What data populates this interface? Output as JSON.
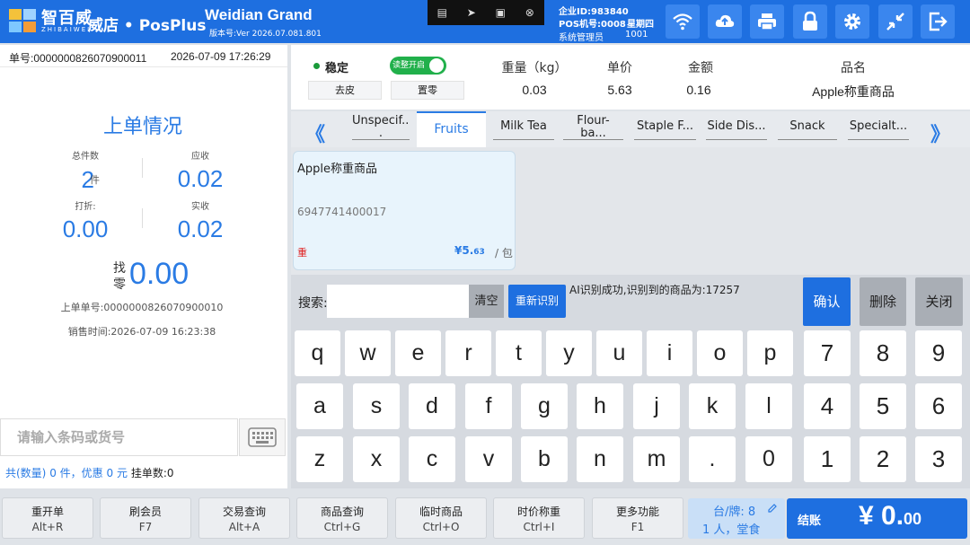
{
  "header": {
    "brand_cn": "智百威",
    "brand_en": "ZHIBAIWEI",
    "app_name": "威店 • PosPlus",
    "store_name": "Weidian Grand",
    "version": "版本号:Ver 2026.07.081.801",
    "company_id": "企业ID:983840",
    "pos_id": "POS机号:0008",
    "weekday": "星期四",
    "role": "系统管理员",
    "user_id": "1001",
    "toolbar_icons": [
      "wifi-icon",
      "cloud-upload-icon",
      "printer-icon",
      "lock-icon",
      "gear-icon",
      "minimize-icon",
      "exit-icon"
    ]
  },
  "order": {
    "number": "单号:0000000826070900011",
    "datetime": "2026-07-09 17:26:29",
    "title": "上单情况",
    "total_count_label": "总件数",
    "total_count": "2",
    "count_unit": "件",
    "receivable_label": "应收",
    "receivable": "0.02",
    "discount_label": "打折:",
    "discount": "0.00",
    "paid_label": "实收",
    "paid": "0.02",
    "change_label": "找零",
    "change": "0.00",
    "last_order": "上单单号:0000000826070900010",
    "sale_time": "销售时间:2026-07-09 16:23:38",
    "barcode_placeholder": "请输入条码或货号",
    "summary_prefix": "共(数量)",
    "summary_qty": "0",
    "summary_mid": "件，优惠",
    "summary_discount": "0",
    "summary_unit": "元",
    "pending_label": "挂单数:0"
  },
  "scale": {
    "stable_label": "稳定",
    "toggle_label": "读整开启",
    "tare_label": "去皮",
    "zero_label": "置零",
    "weight_label": "重量（kg）",
    "weight": "0.03",
    "unit_price_label": "单价",
    "unit_price": "5.63",
    "amount_label": "金额",
    "amount": "0.16",
    "product_label": "品名",
    "product_name": "Apple称重商品"
  },
  "tabs": [
    "Unspecif...",
    "Fruits",
    "Milk Tea",
    "Flour-ba...",
    "Staple F...",
    "Side Dis...",
    "Snack",
    "Specialt..."
  ],
  "tab_unspecified_line1": "Unspecif...",
  "tab_unspecified_line2": ".",
  "tab_flour_line1": "Flour-",
  "tab_flour_line2": "ba...",
  "arrow_left": "《",
  "arrow_right": "》",
  "product_card": {
    "name": "Apple称重商品",
    "code": "6947741400017",
    "weigh_tag": "重",
    "price_main": "¥5.",
    "price_cents": "63",
    "unit": "/ 包"
  },
  "search": {
    "label": "搜索:",
    "value": "",
    "clear_label": "清空",
    "recognize_label": "重新识别",
    "ai_message": "AI识别成功,识别到的商品为:17257"
  },
  "actions": {
    "confirm": "确认",
    "delete": "删除",
    "close": "关闭"
  },
  "keyboard": {
    "row1": [
      "q",
      "w",
      "e",
      "r",
      "t",
      "y",
      "u",
      "i",
      "o",
      "p"
    ],
    "row2": [
      "a",
      "s",
      "d",
      "f",
      "g",
      "h",
      "j",
      "k",
      "l"
    ],
    "row3": [
      "z",
      "x",
      "c",
      "v",
      "b",
      "n",
      "m",
      ".",
      "0"
    ],
    "num_row1": [
      "7",
      "8",
      "9"
    ],
    "num_row2": [
      "4",
      "5",
      "6"
    ],
    "num_row3": [
      "1",
      "2",
      "3"
    ]
  },
  "footer": {
    "buttons": [
      {
        "label": "重开单",
        "shortcut": "Alt+R"
      },
      {
        "label": "刷会员",
        "shortcut": "F7"
      },
      {
        "label": "交易查询",
        "shortcut": "Alt+A"
      },
      {
        "label": "商品查询",
        "shortcut": "Ctrl+G"
      },
      {
        "label": "临时商品",
        "shortcut": "Ctrl+O"
      },
      {
        "label": "时价称重",
        "shortcut": "Ctrl+I"
      },
      {
        "label": "更多功能",
        "shortcut": "F1"
      }
    ],
    "table_label": "台/牌: 8",
    "guests": "1 人，堂食",
    "checkout_label": "结账",
    "checkout_amount": "¥ 0.",
    "checkout_cents": "00"
  },
  "colors": {
    "primary": "#1e6fe0",
    "accent_text": "#2a7be4",
    "stable_green": "#1a9a3a",
    "weigh_red": "#e02020"
  }
}
